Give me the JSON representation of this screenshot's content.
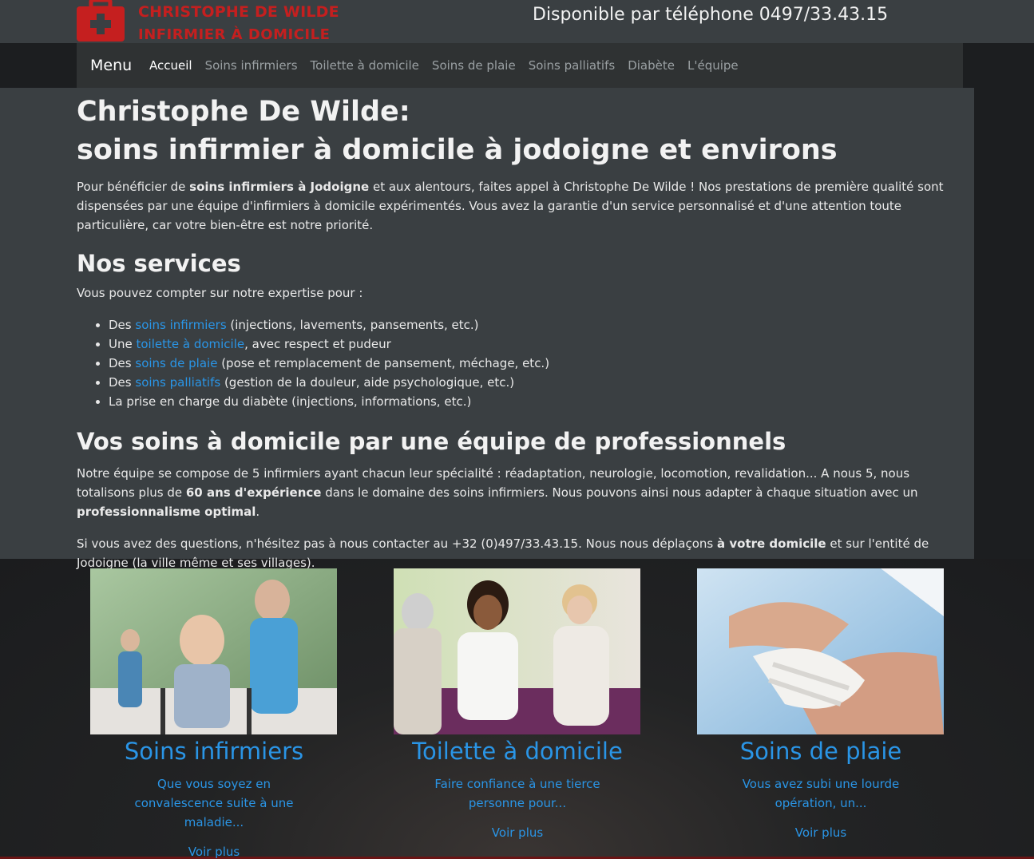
{
  "header": {
    "logo_line1": "CHRISTOPHE DE WILDE",
    "logo_line2": "INFIRMIER À DOMICILE",
    "phone_text": "Disponible par téléphone 0497/33.43.15"
  },
  "nav": {
    "brand": "Menu",
    "items": [
      {
        "label": "Accueil",
        "active": true
      },
      {
        "label": "Soins infirmiers"
      },
      {
        "label": "Toilette à domicile"
      },
      {
        "label": "Soins de plaie"
      },
      {
        "label": "Soins palliatifs"
      },
      {
        "label": "Diabète"
      },
      {
        "label": "L'équipe"
      }
    ]
  },
  "main": {
    "title_line1": "Christophe De Wilde:",
    "title_line2": "soins infirmier à domicile à jodoigne et environs",
    "intro": {
      "before": "Pour bénéficier de ",
      "bold": "soins infirmiers à Jodoigne",
      "after": " et aux alentours, faites appel à Christophe De Wilde ! Nos prestations de première qualité sont dispensées par une équipe d'infirmiers à domicile expérimentés. Vous avez la garantie d'un service personnalisé et d'une attention toute particulière, car votre bien-être est notre priorité."
    },
    "services_heading": "Nos services",
    "services_intro": "Vous pouvez compter sur notre expertise pour :",
    "services": [
      {
        "before": "Des ",
        "link": "soins infirmiers",
        "after": " (injections, lavements, pansements, etc.)"
      },
      {
        "before": "Une ",
        "link": "toilette à domicile",
        "after": ", avec respect et pudeur"
      },
      {
        "before": "Des ",
        "link": "soins de plaie",
        "after": " (pose et remplacement de pansement, méchage, etc.)"
      },
      {
        "before": "Des ",
        "link": "soins palliatifs",
        "after": " (gestion de la douleur, aide psychologique, etc.)"
      },
      {
        "before": "La prise en charge du diabète (injections, informations, etc.)",
        "link": "",
        "after": ""
      }
    ],
    "team_heading": "Vos soins à domicile par une équipe de professionnels",
    "team_p": {
      "t1": "Notre équipe se compose de 5 infirmiers ayant chacun leur spécialité : réadaptation, neurologie, locomotion, revalidation... A nous 5, nous totalisons plus de ",
      "b1": "60 ans d'expérience",
      "t2": " dans le domaine des soins infirmiers. Nous pouvons ainsi nous adapter à chaque situation avec un ",
      "b2": "professionnalisme optimal",
      "t3": "."
    },
    "contact_p": {
      "t1": "Si vous avez des questions, n'hésitez pas à nous contacter au +32 (0)497/33.43.15. Nous nous déplaçons ",
      "b1": "à votre domicile",
      "t2": " et sur l'entité de Jodoigne (la ville même et ses villages)."
    }
  },
  "cards": [
    {
      "title": "Soins infirmiers",
      "desc": "Que vous soyez en convalescence suite à une maladie...",
      "more": "Voir plus"
    },
    {
      "title": "Toilette à domicile",
      "desc": "Faire confiance à une tierce personne pour...",
      "more": "Voir plus"
    },
    {
      "title": "Soins de plaie",
      "desc": "Vous avez subi une lourde opération, un...",
      "more": "Voir plus"
    }
  ],
  "colors": {
    "accent": "#2a95e6",
    "logo_red": "#c51f1f",
    "panel_bg": "#3a3f42",
    "nav_bg": "#2f3233"
  },
  "icons": {
    "logo": "medical-kit-icon"
  }
}
